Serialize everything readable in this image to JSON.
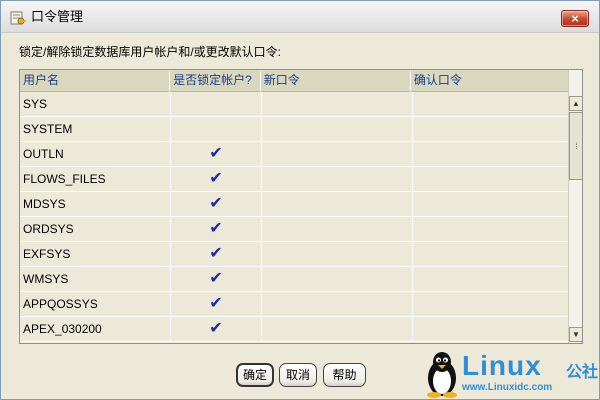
{
  "window": {
    "title": "口令管理",
    "icon": "key-icon",
    "close_label": "×"
  },
  "prompt": "锁定/解除锁定数据库用户帐户和/或更改默认口令:",
  "table": {
    "headers": [
      "用户名",
      "是否锁定帐户?",
      "新口令",
      "确认口令"
    ],
    "rows": [
      {
        "username": "SYS",
        "locked": false,
        "new_password": "",
        "confirm_password": ""
      },
      {
        "username": "SYSTEM",
        "locked": false,
        "new_password": "",
        "confirm_password": ""
      },
      {
        "username": "OUTLN",
        "locked": true,
        "new_password": "",
        "confirm_password": ""
      },
      {
        "username": "FLOWS_FILES",
        "locked": true,
        "new_password": "",
        "confirm_password": ""
      },
      {
        "username": "MDSYS",
        "locked": true,
        "new_password": "",
        "confirm_password": ""
      },
      {
        "username": "ORDSYS",
        "locked": true,
        "new_password": "",
        "confirm_password": ""
      },
      {
        "username": "EXFSYS",
        "locked": true,
        "new_password": "",
        "confirm_password": ""
      },
      {
        "username": "WMSYS",
        "locked": true,
        "new_password": "",
        "confirm_password": ""
      },
      {
        "username": "APPQOSSYS",
        "locked": true,
        "new_password": "",
        "confirm_password": ""
      },
      {
        "username": "APEX_030200",
        "locked": true,
        "new_password": "",
        "confirm_password": ""
      }
    ],
    "check_glyph": "✔"
  },
  "buttons": {
    "ok": "确定",
    "cancel": "取消",
    "help": "帮助"
  },
  "watermark": {
    "brand": "Linux",
    "suffix": "公社",
    "url": "www.Linuxidc.com"
  },
  "colors": {
    "header_text": "#1a3d8a",
    "check": "#1d2aa8",
    "close_button": "#c9452b",
    "brand": "#2f8ed8"
  }
}
